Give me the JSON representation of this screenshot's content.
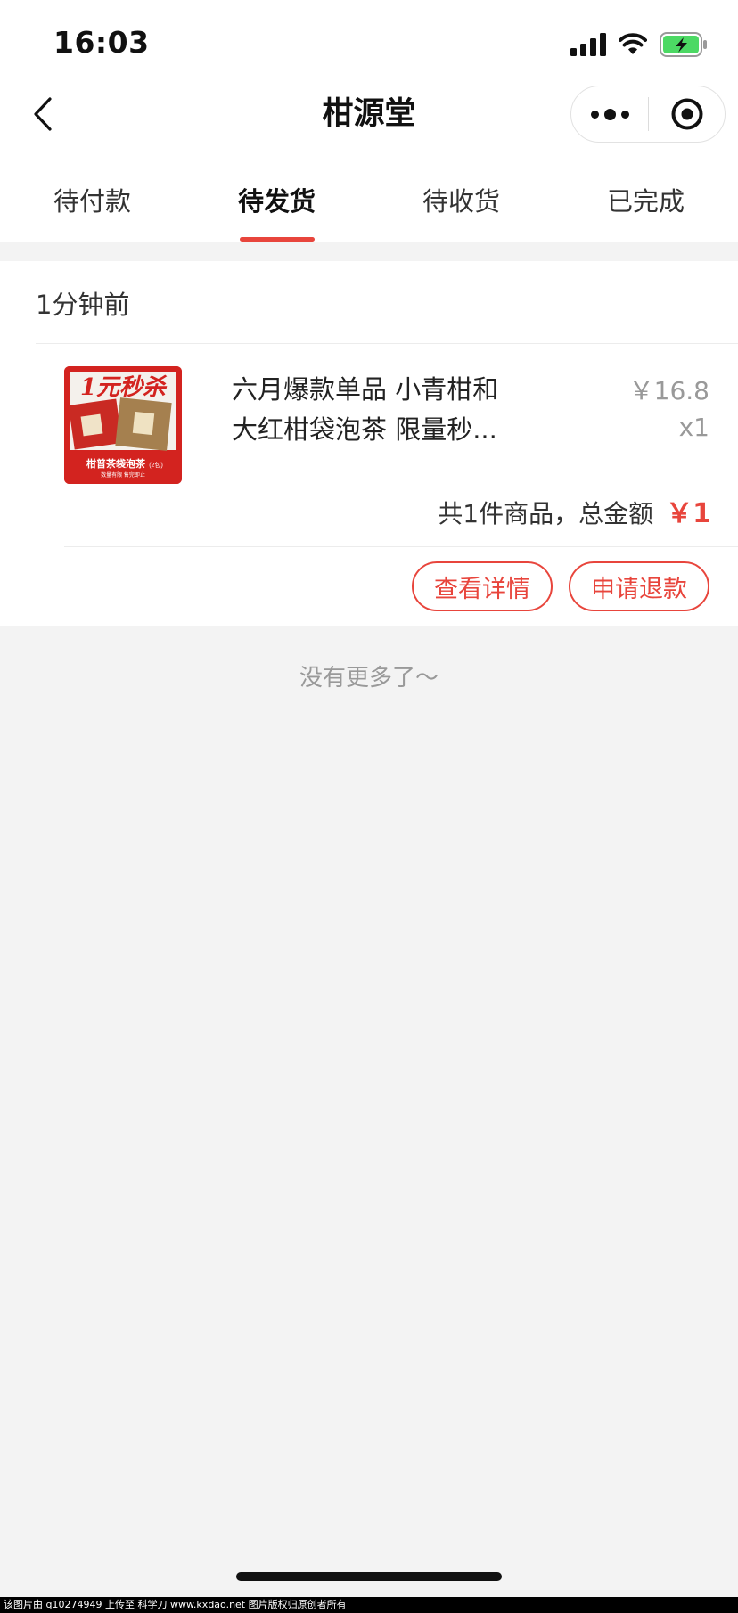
{
  "status_bar": {
    "time": "16:03"
  },
  "nav": {
    "title": "柑源堂"
  },
  "tabs": [
    {
      "label": "待付款"
    },
    {
      "label": "待发货",
      "active": true
    },
    {
      "label": "待收货"
    },
    {
      "label": "已完成"
    }
  ],
  "order": {
    "time": "1分钟前",
    "product": {
      "title_line1": "六月爆款单品 小青柑和",
      "title_line2": "大红柑袋泡茶 限量秒...",
      "image_text_main": "1元秒杀",
      "image_text_sub": "柑普茶袋泡茶",
      "image_text_sub2": "(2包)",
      "image_text_small": "数量有限 售完即止",
      "unit_price": "￥16.8",
      "quantity": "x1"
    },
    "summary_label": "共1件商品，总金额",
    "total": "￥1",
    "buttons": {
      "detail": "查看详情",
      "refund": "申请退款"
    }
  },
  "footer": {
    "no_more": "没有更多了～"
  },
  "watermark": "该图片由 q10274949 上传至 科学刀 www.kxdao.net 图片版权归原创者所有",
  "colors": {
    "accent": "#e8453c",
    "battery": "#4cd964",
    "background": "#f3f3f3"
  }
}
